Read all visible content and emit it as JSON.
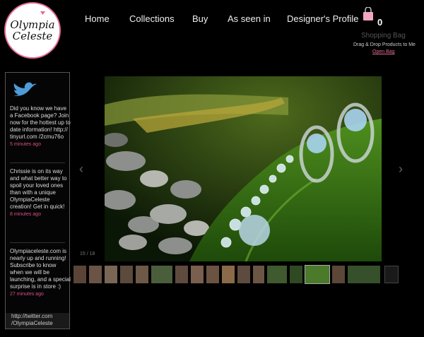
{
  "brand": {
    "logo_line1": "Olympia",
    "logo_line2": "Celeste",
    "accent": "#e36a97"
  },
  "nav": [
    {
      "label": "Home"
    },
    {
      "label": "Collections"
    },
    {
      "label": "Buy"
    },
    {
      "label": "As seen in"
    },
    {
      "label": "Designer's Profile"
    }
  ],
  "bag": {
    "count": "0",
    "title": "Shopping Bag",
    "hint": "Drag & Drop Products to Me",
    "open_label": "Open Bag"
  },
  "twitter": {
    "icon": "bird-icon",
    "tweets": [
      {
        "text": "Did you know we have a Facebook page? Join now for the hottest up to date information! http:// tinyurl.com /2cmu76o",
        "time": "5 minutes ago"
      },
      {
        "text": "Chrissie is on its way and what better way to spoil your loved ones than with a unique OlympiaCeleste creation! Get in quick!",
        "time": "8 minutes ago"
      },
      {
        "text": "Olympiaceleste.com is nearly up and running! Subscribe to know when we will be launching, and a special surprise is in store :)",
        "time": "27 minutes ago"
      }
    ],
    "link_line1": "http://twitter.com",
    "link_line2": "/OlympiaCeleste"
  },
  "gallery": {
    "counter": "15 / 18",
    "prev_icon": "chevron-left-icon",
    "next_icon": "chevron-right-icon",
    "thumbnail_count": 18
  }
}
